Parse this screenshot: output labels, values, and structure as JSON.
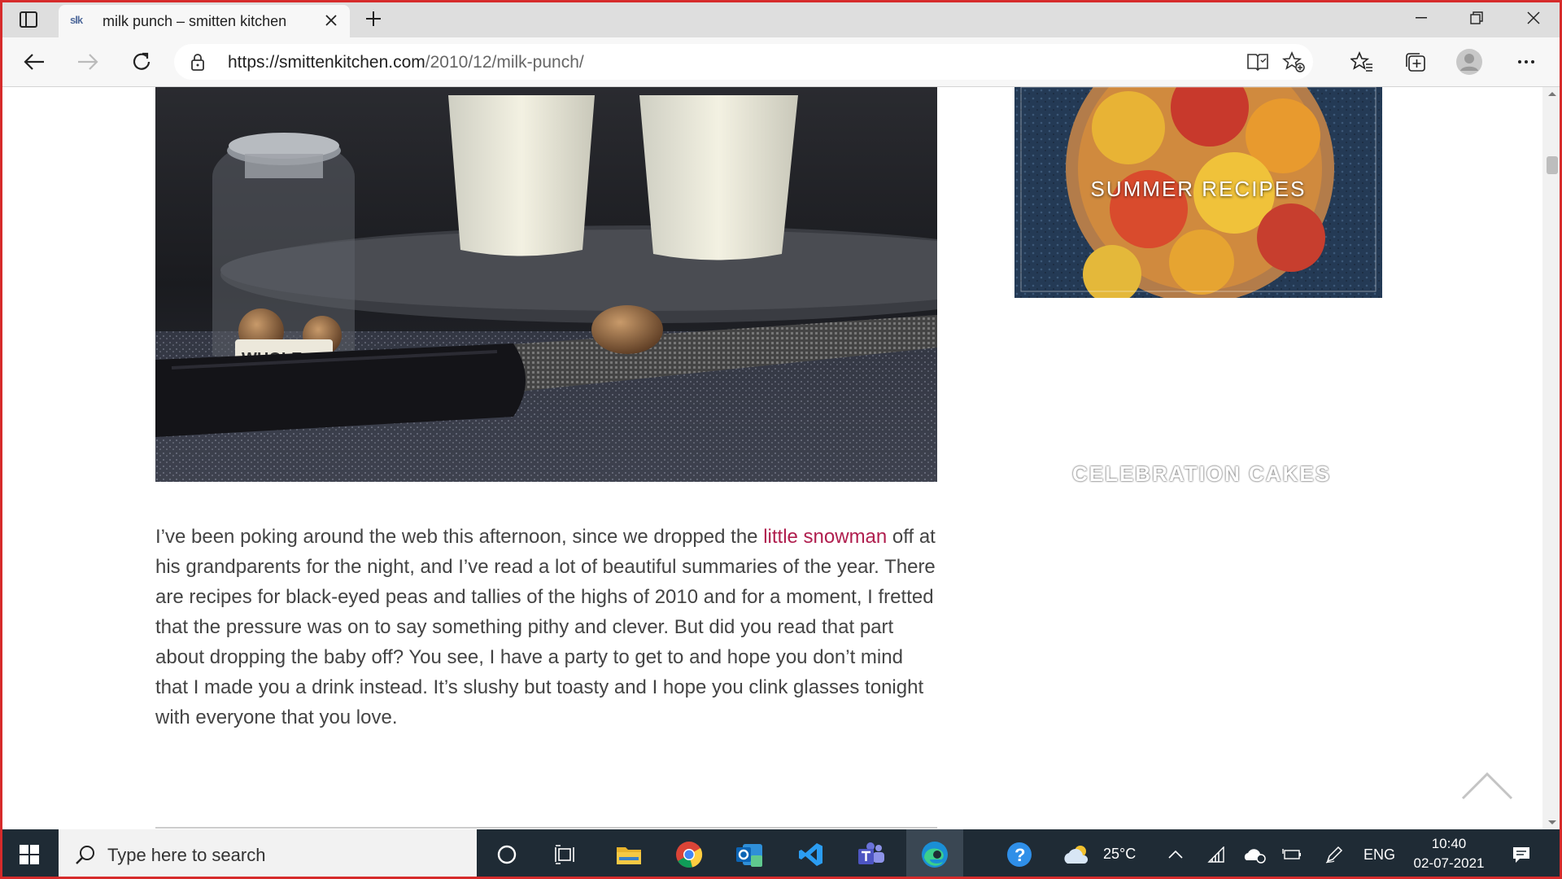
{
  "browser": {
    "tab": {
      "favicon_text": "slk",
      "title": "milk punch – smitten kitchen"
    },
    "address": {
      "domain": "https://smittenkitchen.com",
      "path": "/2010/12/milk-punch/"
    }
  },
  "hero": {
    "jar_label": "WHOLE"
  },
  "sidebar": {
    "summer_label": "SUMMER RECIPES",
    "celebration_label": "CELEBRATION CAKES"
  },
  "article": {
    "p1_before": "I’ve been poking around the web this afternoon, since we dropped the ",
    "p1_link": "little snowman",
    "p1_after": " off at his grandparents for the night, and I’ve read a lot of beautiful summaries of the year. There are recipes for black-eyed peas and tallies of the highs of 2010 and for a moment, I fretted that the pressure was on to say something pithy and clever. But did you read that part about dropping the baby off? You see, I have a party to get to and hope you don’t mind that I made you a drink instead. It’s slushy but toasty and I hope you clink glasses tonight with everyone that you love."
  },
  "taskbar": {
    "search_placeholder": "Type here to search",
    "weather": "25°C",
    "language": "ENG",
    "time": "10:40",
    "date": "02-07-2021"
  },
  "colors": {
    "link": "#b01e4e",
    "taskbar": "#1f2b35",
    "frame": "#d62b2b"
  }
}
